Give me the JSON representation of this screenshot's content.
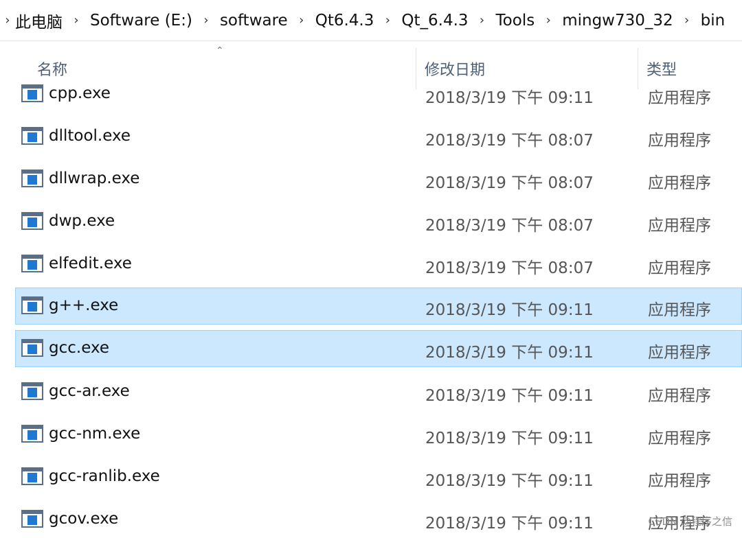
{
  "breadcrumb": [
    "此电脑",
    "Software (E:)",
    "software",
    "Qt6.4.3",
    "Qt_6.4.3",
    "Tools",
    "mingw730_32",
    "bin"
  ],
  "columns": {
    "name": "名称",
    "modified": "修改日期",
    "type": "类型"
  },
  "files": [
    {
      "name": "cpp.exe",
      "date": "2018/3/19 下午 09:11",
      "type": "应用程序",
      "selected": false
    },
    {
      "name": "dlltool.exe",
      "date": "2018/3/19 下午 08:07",
      "type": "应用程序",
      "selected": false
    },
    {
      "name": "dllwrap.exe",
      "date": "2018/3/19 下午 08:07",
      "type": "应用程序",
      "selected": false
    },
    {
      "name": "dwp.exe",
      "date": "2018/3/19 下午 08:07",
      "type": "应用程序",
      "selected": false
    },
    {
      "name": "elfedit.exe",
      "date": "2018/3/19 下午 08:07",
      "type": "应用程序",
      "selected": false
    },
    {
      "name": "g++.exe",
      "date": "2018/3/19 下午 09:11",
      "type": "应用程序",
      "selected": true
    },
    {
      "name": "gcc.exe",
      "date": "2018/3/19 下午 09:11",
      "type": "应用程序",
      "selected": true
    },
    {
      "name": "gcc-ar.exe",
      "date": "2018/3/19 下午 09:11",
      "type": "应用程序",
      "selected": false
    },
    {
      "name": "gcc-nm.exe",
      "date": "2018/3/19 下午 09:11",
      "type": "应用程序",
      "selected": false
    },
    {
      "name": "gcc-ranlib.exe",
      "date": "2018/3/19 下午 09:11",
      "type": "应用程序",
      "selected": false
    },
    {
      "name": "gcov.exe",
      "date": "2018/3/19 下午 09:11",
      "type": "应用程序",
      "selected": false
    }
  ],
  "watermark": "CSDN @程序之信",
  "colors": {
    "selection_bg": "#cce8ff",
    "selection_border": "#99d1ff",
    "header_text": "#4c607a",
    "icon_blue": "#1f78d1"
  },
  "icons": {
    "breadcrumb_separator": "chevron-right-icon",
    "file": "application-exe-icon",
    "sort": "sort-up-icon"
  }
}
